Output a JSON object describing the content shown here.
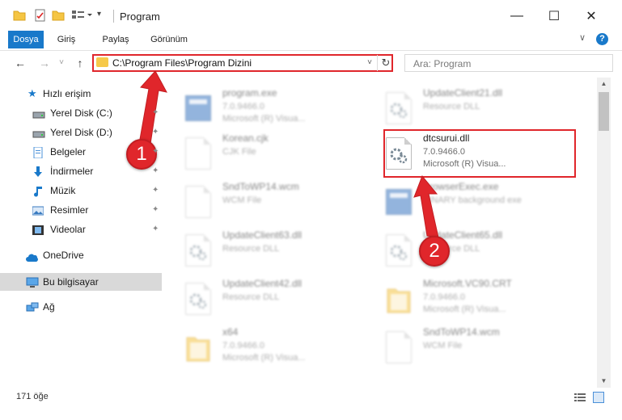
{
  "window": {
    "title": "Program",
    "min_glyph": "—",
    "max_glyph": "☐",
    "close_glyph": "✕"
  },
  "ribbon": {
    "tabs": [
      "Dosya",
      "Giriş",
      "Paylaş",
      "Görünüm"
    ],
    "help_glyph": "?",
    "chevron_glyph": "∨"
  },
  "navigation": {
    "back_glyph": "←",
    "forward_glyph": "→",
    "recent_glyph": "˅",
    "up_glyph": "↑",
    "address": "C:\\Program Files\\Program Dizini",
    "address_dropdown_glyph": "˅",
    "refresh_glyph": "↻",
    "search_placeholder": "Ara: Program"
  },
  "sidebar": {
    "quick_access": "Hızlı erişim",
    "items": [
      {
        "label": "Yerel Disk (C:)",
        "icon": "drive-icon"
      },
      {
        "label": "Yerel Disk (D:)",
        "icon": "drive-icon"
      },
      {
        "label": "Belgeler",
        "icon": "documents-icon"
      },
      {
        "label": "İndirmeler",
        "icon": "downloads-icon"
      },
      {
        "label": "Müzik",
        "icon": "music-icon"
      },
      {
        "label": "Resimler",
        "icon": "pictures-icon"
      },
      {
        "label": "Videolar",
        "icon": "videos-icon"
      }
    ],
    "pin_glyph": "📌",
    "onedrive": "OneDrive",
    "this_pc": "Bu bilgisayar",
    "network": "Ağ"
  },
  "files": [
    {
      "name": "program.exe",
      "line1": "7.0.9466.0",
      "line2": "Microsoft (R) Visua...",
      "icon": "exe-icon",
      "col": 0,
      "row": 0,
      "selected": false
    },
    {
      "name": "UpdateClient21.dll",
      "line1": "Resource DLL",
      "line2": "",
      "icon": "dll-icon",
      "col": 1,
      "row": 0,
      "selected": false
    },
    {
      "name": "Korean.cjk",
      "line1": "CJK File",
      "line2": "",
      "icon": "file-icon",
      "col": 0,
      "row": 1,
      "selected": false
    },
    {
      "name": "dtcsurui.dll",
      "line1": "7.0.9466.0",
      "line2": "Microsoft (R) Visua...",
      "icon": "dll-icon",
      "col": 1,
      "row": 1,
      "selected": true
    },
    {
      "name": "SndToWP14.wcm",
      "line1": "WCM File",
      "line2": "",
      "icon": "file-icon",
      "col": 0,
      "row": 2,
      "selected": false
    },
    {
      "name": "BrowserExec.exe",
      "line1": "BINARY background exe",
      "line2": "",
      "icon": "exe-icon",
      "col": 1,
      "row": 2,
      "selected": false
    },
    {
      "name": "UpdateClient63.dll",
      "line1": "Resource DLL",
      "line2": "",
      "icon": "dll-icon",
      "col": 0,
      "row": 3,
      "selected": false
    },
    {
      "name": "UpdateClient65.dll",
      "line1": "Resource DLL",
      "line2": "",
      "icon": "dll-icon",
      "col": 1,
      "row": 3,
      "selected": false
    },
    {
      "name": "UpdateClient42.dll",
      "line1": "Resource DLL",
      "line2": "",
      "icon": "dll-icon",
      "col": 0,
      "row": 4,
      "selected": false
    },
    {
      "name": "Microsoft.VC90.CRT",
      "line1": "7.0.9466.0",
      "line2": "Microsoft (R) Visua...",
      "icon": "folder-icon",
      "col": 1,
      "row": 4,
      "selected": false
    },
    {
      "name": "x64",
      "line1": "7.0.9466.0",
      "line2": "Microsoft (R) Visua...",
      "icon": "folder-icon",
      "col": 0,
      "row": 5,
      "selected": false
    },
    {
      "name": "SndToWP14.wcm",
      "line1": "WCM File",
      "line2": "",
      "icon": "file-icon",
      "col": 1,
      "row": 5,
      "selected": false
    }
  ],
  "status": {
    "item_count": "171 öğe"
  },
  "annotations": {
    "step1": "1",
    "step2": "2"
  },
  "colors": {
    "accent": "#1979ca",
    "highlight": "#e0262b"
  }
}
